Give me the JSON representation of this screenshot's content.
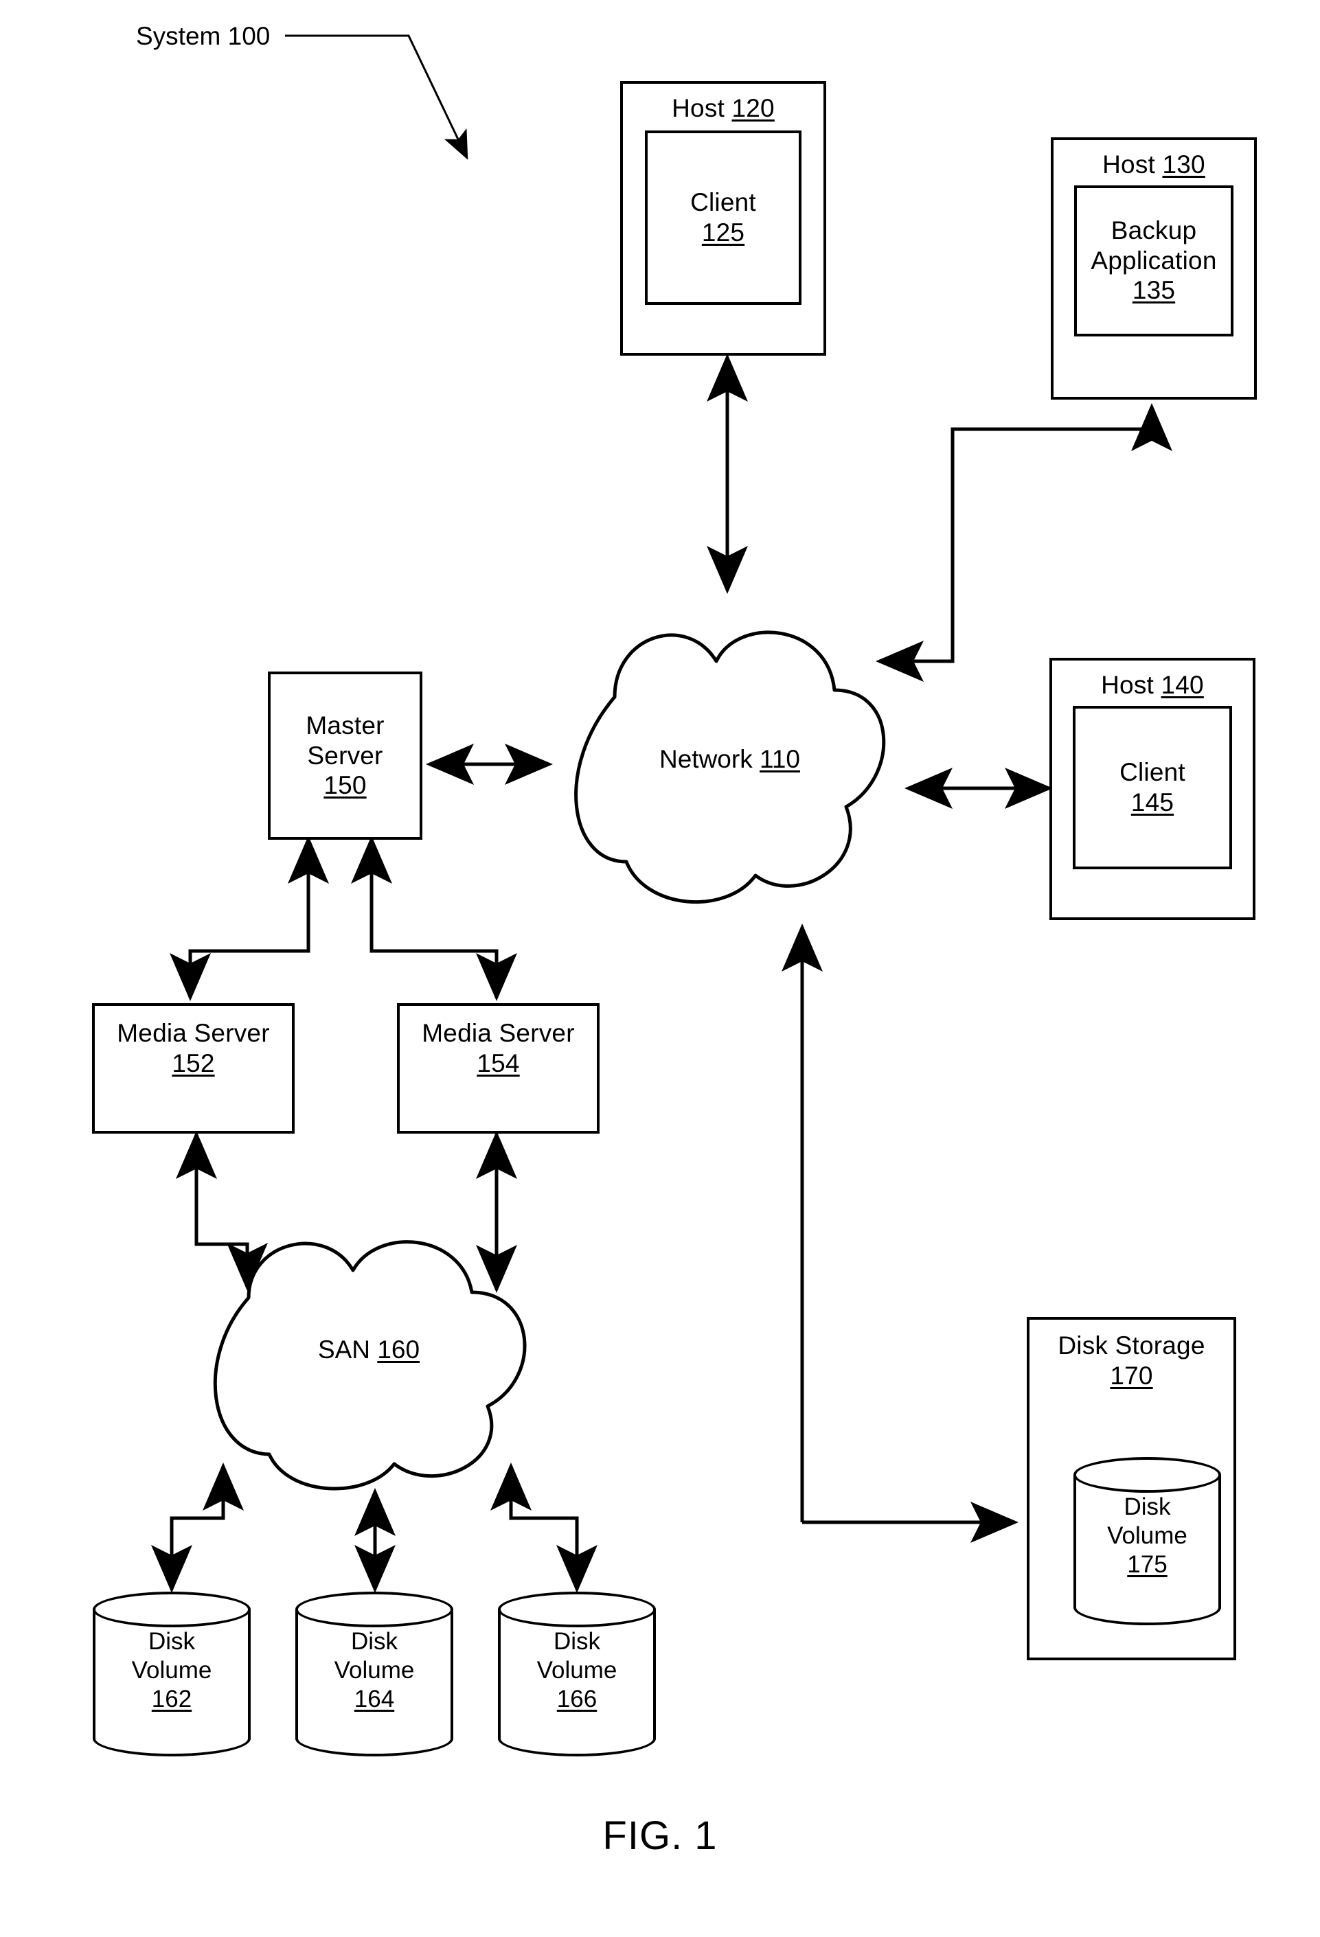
{
  "figure": {
    "caption": "FIG. 1",
    "system_label": "System 100"
  },
  "nodes": {
    "host120": {
      "title": "Host ",
      "title_num": "120",
      "child_line1": "Client",
      "child_num": "125"
    },
    "host130": {
      "title": "Host ",
      "title_num": "130",
      "child_line1": "Backup",
      "child_line2": "Application",
      "child_num": "135"
    },
    "host140": {
      "title": "Host ",
      "title_num": "140",
      "child_line1": "Client",
      "child_num": "145"
    },
    "network110": {
      "name": "Network ",
      "num": "110"
    },
    "master150": {
      "line1": "Master",
      "line2": "Server",
      "num": "150"
    },
    "media152": {
      "line1": "Media Server",
      "num": "152"
    },
    "media154": {
      "line1": "Media Server",
      "num": "154"
    },
    "san160": {
      "name": "SAN ",
      "num": "160"
    },
    "disk162": {
      "line1": "Disk",
      "line2": "Volume",
      "num": "162"
    },
    "disk164": {
      "line1": "Disk",
      "line2": "Volume",
      "num": "164"
    },
    "disk166": {
      "line1": "Disk",
      "line2": "Volume",
      "num": "166"
    },
    "diskstorage170": {
      "line1": "Disk Storage",
      "num": "170"
    },
    "disk175": {
      "line1": "Disk",
      "line2": "Volume",
      "num": "175"
    }
  },
  "colors": {
    "line": "#000000",
    "background": "#ffffff"
  }
}
